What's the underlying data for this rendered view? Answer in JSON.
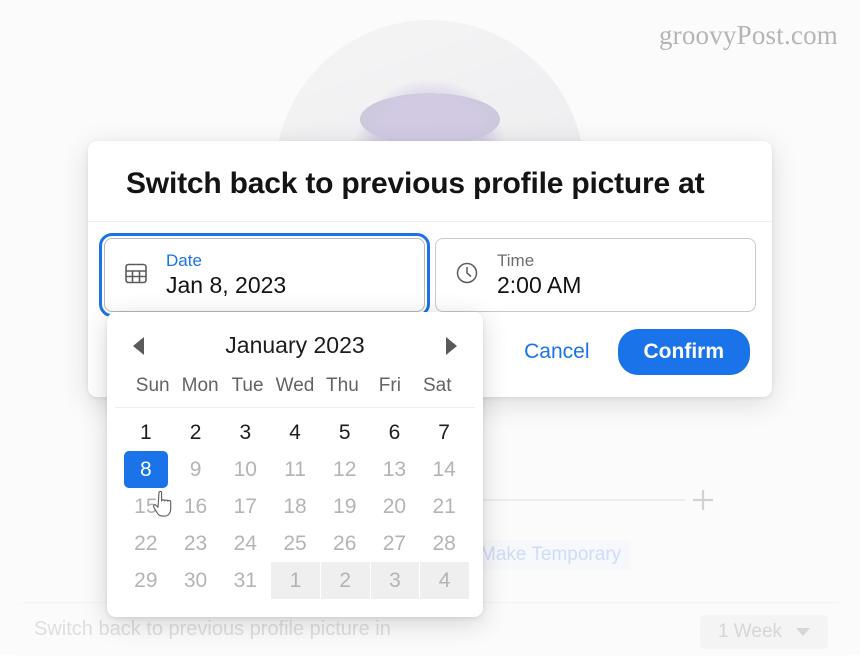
{
  "watermark": "groovyPost.com",
  "background": {
    "avatar_alt": "profile-photo-football-player",
    "make_temporary_label": "Make Temporary",
    "add_icon": "plus-icon",
    "bottom_label": "Switch back to previous profile picture in",
    "duration_value": "1 Week"
  },
  "dialog": {
    "title": "Switch back to previous profile picture at",
    "date_field": {
      "icon": "calendar-icon",
      "label": "Date",
      "value": "Jan 8, 2023"
    },
    "time_field": {
      "icon": "clock-icon",
      "label": "Time",
      "value": "2:00 AM"
    },
    "cancel_label": "Cancel",
    "confirm_label": "Confirm"
  },
  "calendar": {
    "prev_icon": "chevron-left-icon",
    "next_icon": "chevron-right-icon",
    "month_label": "January 2023",
    "weekdays": [
      "Sun",
      "Mon",
      "Tue",
      "Wed",
      "Thu",
      "Fri",
      "Sat"
    ],
    "selected_day": 8,
    "cells": [
      {
        "d": "1",
        "state": "current"
      },
      {
        "d": "2",
        "state": "current"
      },
      {
        "d": "3",
        "state": "current"
      },
      {
        "d": "4",
        "state": "current"
      },
      {
        "d": "5",
        "state": "current"
      },
      {
        "d": "6",
        "state": "current"
      },
      {
        "d": "7",
        "state": "current"
      },
      {
        "d": "8",
        "state": "selected"
      },
      {
        "d": "9",
        "state": "dim"
      },
      {
        "d": "10",
        "state": "dim"
      },
      {
        "d": "11",
        "state": "dim"
      },
      {
        "d": "12",
        "state": "dim"
      },
      {
        "d": "13",
        "state": "dim"
      },
      {
        "d": "14",
        "state": "dim"
      },
      {
        "d": "15",
        "state": "dim"
      },
      {
        "d": "16",
        "state": "dim"
      },
      {
        "d": "17",
        "state": "dim"
      },
      {
        "d": "18",
        "state": "dim"
      },
      {
        "d": "19",
        "state": "dim"
      },
      {
        "d": "20",
        "state": "dim"
      },
      {
        "d": "21",
        "state": "dim"
      },
      {
        "d": "22",
        "state": "dim"
      },
      {
        "d": "23",
        "state": "dim"
      },
      {
        "d": "24",
        "state": "dim"
      },
      {
        "d": "25",
        "state": "dim"
      },
      {
        "d": "26",
        "state": "dim"
      },
      {
        "d": "27",
        "state": "dim"
      },
      {
        "d": "28",
        "state": "dim"
      },
      {
        "d": "29",
        "state": "dim"
      },
      {
        "d": "30",
        "state": "dim"
      },
      {
        "d": "31",
        "state": "dim"
      },
      {
        "d": "1",
        "state": "outside"
      },
      {
        "d": "2",
        "state": "outside"
      },
      {
        "d": "3",
        "state": "outside"
      },
      {
        "d": "4",
        "state": "outside"
      }
    ]
  },
  "colors": {
    "accent": "#1a73e8",
    "selected_day_bg": "#1a73e8",
    "dialog_bg": "#ffffff",
    "dim_text": "#b4b4b6"
  }
}
